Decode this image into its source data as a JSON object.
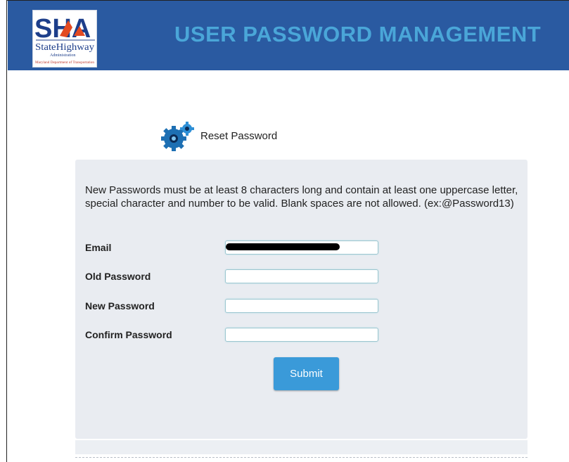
{
  "header": {
    "logo": {
      "main_text": "SHA",
      "sub_text": "StateHighway",
      "sub_text_small": "Administration",
      "tagline": "Maryland Department of Transportation"
    },
    "title": "USER PASSWORD MANAGEMENT"
  },
  "section": {
    "icon": "gears-icon",
    "title": "Reset Password"
  },
  "form": {
    "instructions": "New Passwords must be at least 8 characters long and contain at least one uppercase letter, special character and number to be valid. Blank spaces are not allowed. (ex:@Password13)",
    "fields": [
      {
        "label": "Email",
        "value": "",
        "redacted": true
      },
      {
        "label": "Old Password",
        "value": ""
      },
      {
        "label": "New Password",
        "value": ""
      },
      {
        "label": "Confirm Password",
        "value": ""
      }
    ],
    "submit_label": "Submit"
  },
  "colors": {
    "header_bg": "#2a5aa1",
    "title_text": "#4aa6d8",
    "panel_bg": "#e9ecf1",
    "submit_bg": "#3a9ad9"
  }
}
